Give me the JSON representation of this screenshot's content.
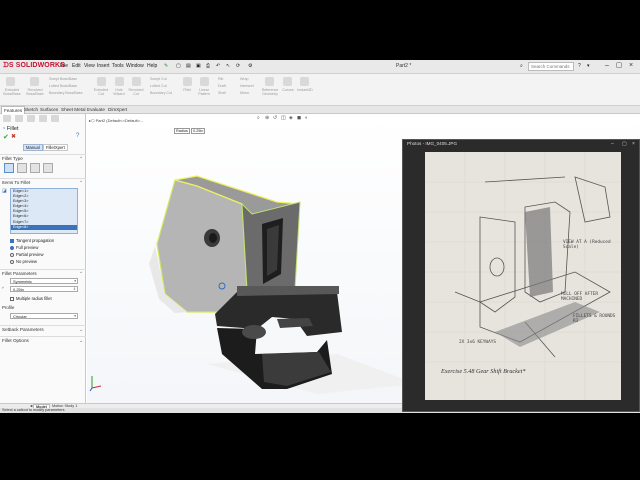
{
  "app": {
    "logo": "SOLIDWORKS",
    "menus": [
      "File",
      "Edit",
      "View",
      "Insert",
      "Tools",
      "Window",
      "Help"
    ],
    "document_title": "Part2 *",
    "search_placeholder": "Search Commands"
  },
  "command_manager": {
    "items": [
      "Extruded Boss/Base",
      "Revolved Boss/Base",
      "Swept Boss/Base",
      "Lofted Boss/Base",
      "Boundary Boss/Base",
      "Extruded Cut",
      "Hole Wizard",
      "Revolved Cut",
      "Swept Cut",
      "Lofted Cut",
      "Boundary Cut",
      "Fillet",
      "Linear Pattern",
      "Rib",
      "Draft",
      "Shell",
      "Wrap",
      "Intersect",
      "Mirror",
      "Reference Geometry",
      "Curves",
      "Instant3D"
    ]
  },
  "tabs": [
    "Features",
    "Sketch",
    "Surfaces",
    "Sheet Metal",
    "Evaluate",
    "DimXpert"
  ],
  "property_manager": {
    "title": "Fillet",
    "mode_manual": "Manual",
    "mode_xpert": "FilletXpert",
    "sections": {
      "fillet_type": "Fillet Type",
      "items_to_fillet": "Items To Fillet",
      "fillet_parameters": "Fillet Parameters",
      "profile": "Profile",
      "setback": "Setback Parameters",
      "options": "Fillet Options"
    },
    "edges": [
      "Edge<1>",
      "Edge<2>",
      "Edge<3>",
      "Edge<4>",
      "Edge<5>",
      "Edge<6>",
      "Edge<7>",
      "Edge<8>"
    ],
    "selected_edge": "Edge<8>",
    "tangent_propagation": "Tangent propagation",
    "full_preview": "Full preview",
    "partial_preview": "Partial preview",
    "no_preview": "No preview",
    "param_method": "Symmetric",
    "radius": "0.25in",
    "multiple_radius": "Multiple radius fillet",
    "profile_value": "Circular"
  },
  "viewport": {
    "tree_node": "Part2 (Default<<Default>...",
    "fillet_callout_label": "Radius",
    "fillet_callout_value": "0.25in"
  },
  "bottom_tabs": [
    "Model",
    "Motion Study 1"
  ],
  "status": "Select a callout to modify parameters",
  "photos": {
    "title": "Photos - IMG_0405.JPG",
    "caption": "Exercise  5.48  Gear Shift Bracket*",
    "notes": [
      "VIEW AT A (Reduced Scale)",
      "MILL OFF AFTER MACHINED",
      "FILLETS & ROUNDS R3",
      "2X 3x6 KEYWAYS"
    ]
  },
  "colors": {
    "accent": "#3a73bd",
    "logo": "#c8102e",
    "preview": "#f0f060"
  }
}
